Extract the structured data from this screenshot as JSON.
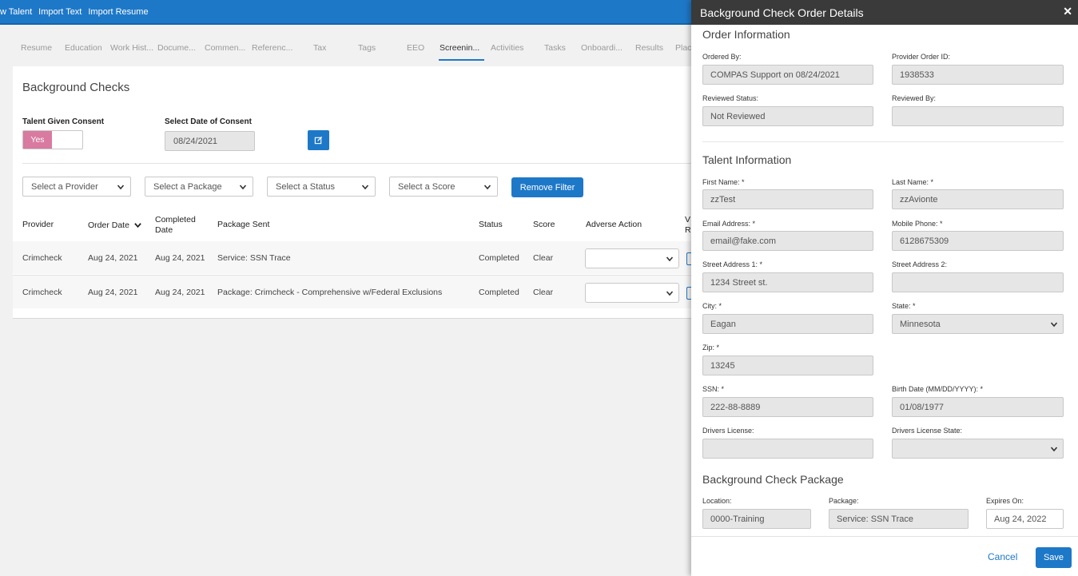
{
  "topbar": {
    "links": [
      "w Talent",
      "Import Text",
      "Import Resume"
    ]
  },
  "tabs": [
    "Resume",
    "Education",
    "Work Hist...",
    "Docume...",
    "Commen...",
    "Referenc...",
    "Tax",
    "Tags",
    "EEO",
    "Screenin...",
    "Activities",
    "Tasks",
    "Onboardi...",
    "Results",
    "Plac"
  ],
  "active_tab": "Screenin...",
  "card": {
    "title": "Background Checks",
    "consent_label": "Talent Given Consent",
    "consent_value": "Yes",
    "date_label": "Select Date of Consent",
    "date_value": "08/24/2021",
    "filters": {
      "provider": "Select a Provider",
      "package": "Select a Package",
      "status": "Select a Status",
      "score": "Select a Score",
      "remove": "Remove Filter"
    },
    "headers": {
      "provider": "Provider",
      "order_date": "Order Date",
      "completed_1": "Completed",
      "completed_2": "Date",
      "package": "Package Sent",
      "status": "Status",
      "score": "Score",
      "adverse": "Adverse Action",
      "v1": "V",
      "v2": "R"
    },
    "rows": [
      {
        "provider": "Crimcheck",
        "order_date": "Aug 24, 2021",
        "completed": "Aug 24, 2021",
        "package": "Service: SSN Trace",
        "status": "Completed",
        "score": "Clear"
      },
      {
        "provider": "Crimcheck",
        "order_date": "Aug 24, 2021",
        "completed": "Aug 24, 2021",
        "package": "Package: Crimcheck - Comprehensive w/Federal Exclusions",
        "status": "Completed",
        "score": "Clear"
      }
    ]
  },
  "panel": {
    "title": "Background Check Order Details",
    "close": "✕",
    "order_section": "Order Information",
    "ordered_by_label": "Ordered By:",
    "ordered_by": "COMPAS Support on 08/24/2021",
    "provider_order_label": "Provider Order ID:",
    "provider_order": "1938533",
    "reviewed_status_label": "Reviewed Status:",
    "reviewed_status": "Not Reviewed",
    "reviewed_by_label": "Reviewed By:",
    "reviewed_by": "",
    "talent_section": "Talent Information",
    "first_name_label": "First Name: *",
    "first_name": "zzTest",
    "last_name_label": "Last Name: *",
    "last_name": "zzAvionte",
    "email_label": "Email Address: *",
    "email": "email@fake.com",
    "mobile_label": "Mobile Phone: *",
    "mobile": "6128675309",
    "street1_label": "Street Address 1: *",
    "street1": "1234 Street st.",
    "street2_label": "Street Address 2:",
    "street2": "",
    "city_label": "City: *",
    "city": "Eagan",
    "state_label": "State: *",
    "state": "Minnesota",
    "zip_label": "Zip: *",
    "zip": "13245",
    "ssn_label": "SSN: *",
    "ssn": "222-88-8889",
    "birth_label": "Birth Date (MM/DD/YYYY): *",
    "birth": "01/08/1977",
    "dl_label": "Drivers License:",
    "dl": "",
    "dl_state_label": "Drivers License State:",
    "dl_state": "",
    "package_section": "Background Check Package",
    "location_label": "Location:",
    "location": "0000-Training",
    "package_label": "Package:",
    "package": "Service: SSN Trace",
    "expires_label": "Expires On:",
    "expires": "Aug 24, 2022",
    "cancel": "Cancel",
    "save": "Save"
  },
  "colors": {
    "primary": "#1e78c8",
    "toggle_on": "#d97aa0",
    "panel_header": "#3a3a3a"
  }
}
